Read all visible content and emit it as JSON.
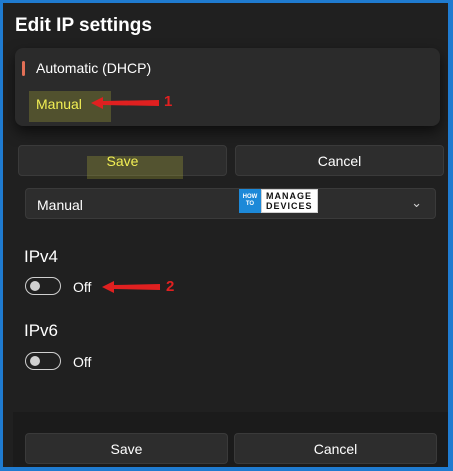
{
  "title": "Edit IP settings",
  "dropdown": {
    "options": [
      {
        "label": "Automatic (DHCP)"
      },
      {
        "label": "Manual"
      }
    ]
  },
  "buttons_top": {
    "save": "Save",
    "cancel": "Cancel"
  },
  "select": {
    "value": "Manual",
    "chevron": "chevron-down-icon"
  },
  "logo": {
    "line1": "HOW",
    "line2": "TO",
    "line3": "MANAGE",
    "line4": "DEVICES"
  },
  "ipv4": {
    "heading": "IPv4",
    "toggle_state": "Off"
  },
  "ipv6": {
    "heading": "IPv6",
    "toggle_state": "Off"
  },
  "buttons_bottom": {
    "save": "Save",
    "cancel": "Cancel"
  },
  "annotations": {
    "a1": "1",
    "a2": "2"
  },
  "colors": {
    "annotation": "#e02020",
    "highlight": "#f2ef54",
    "accent": "#e26f56",
    "frame": "#1f7bd0"
  }
}
